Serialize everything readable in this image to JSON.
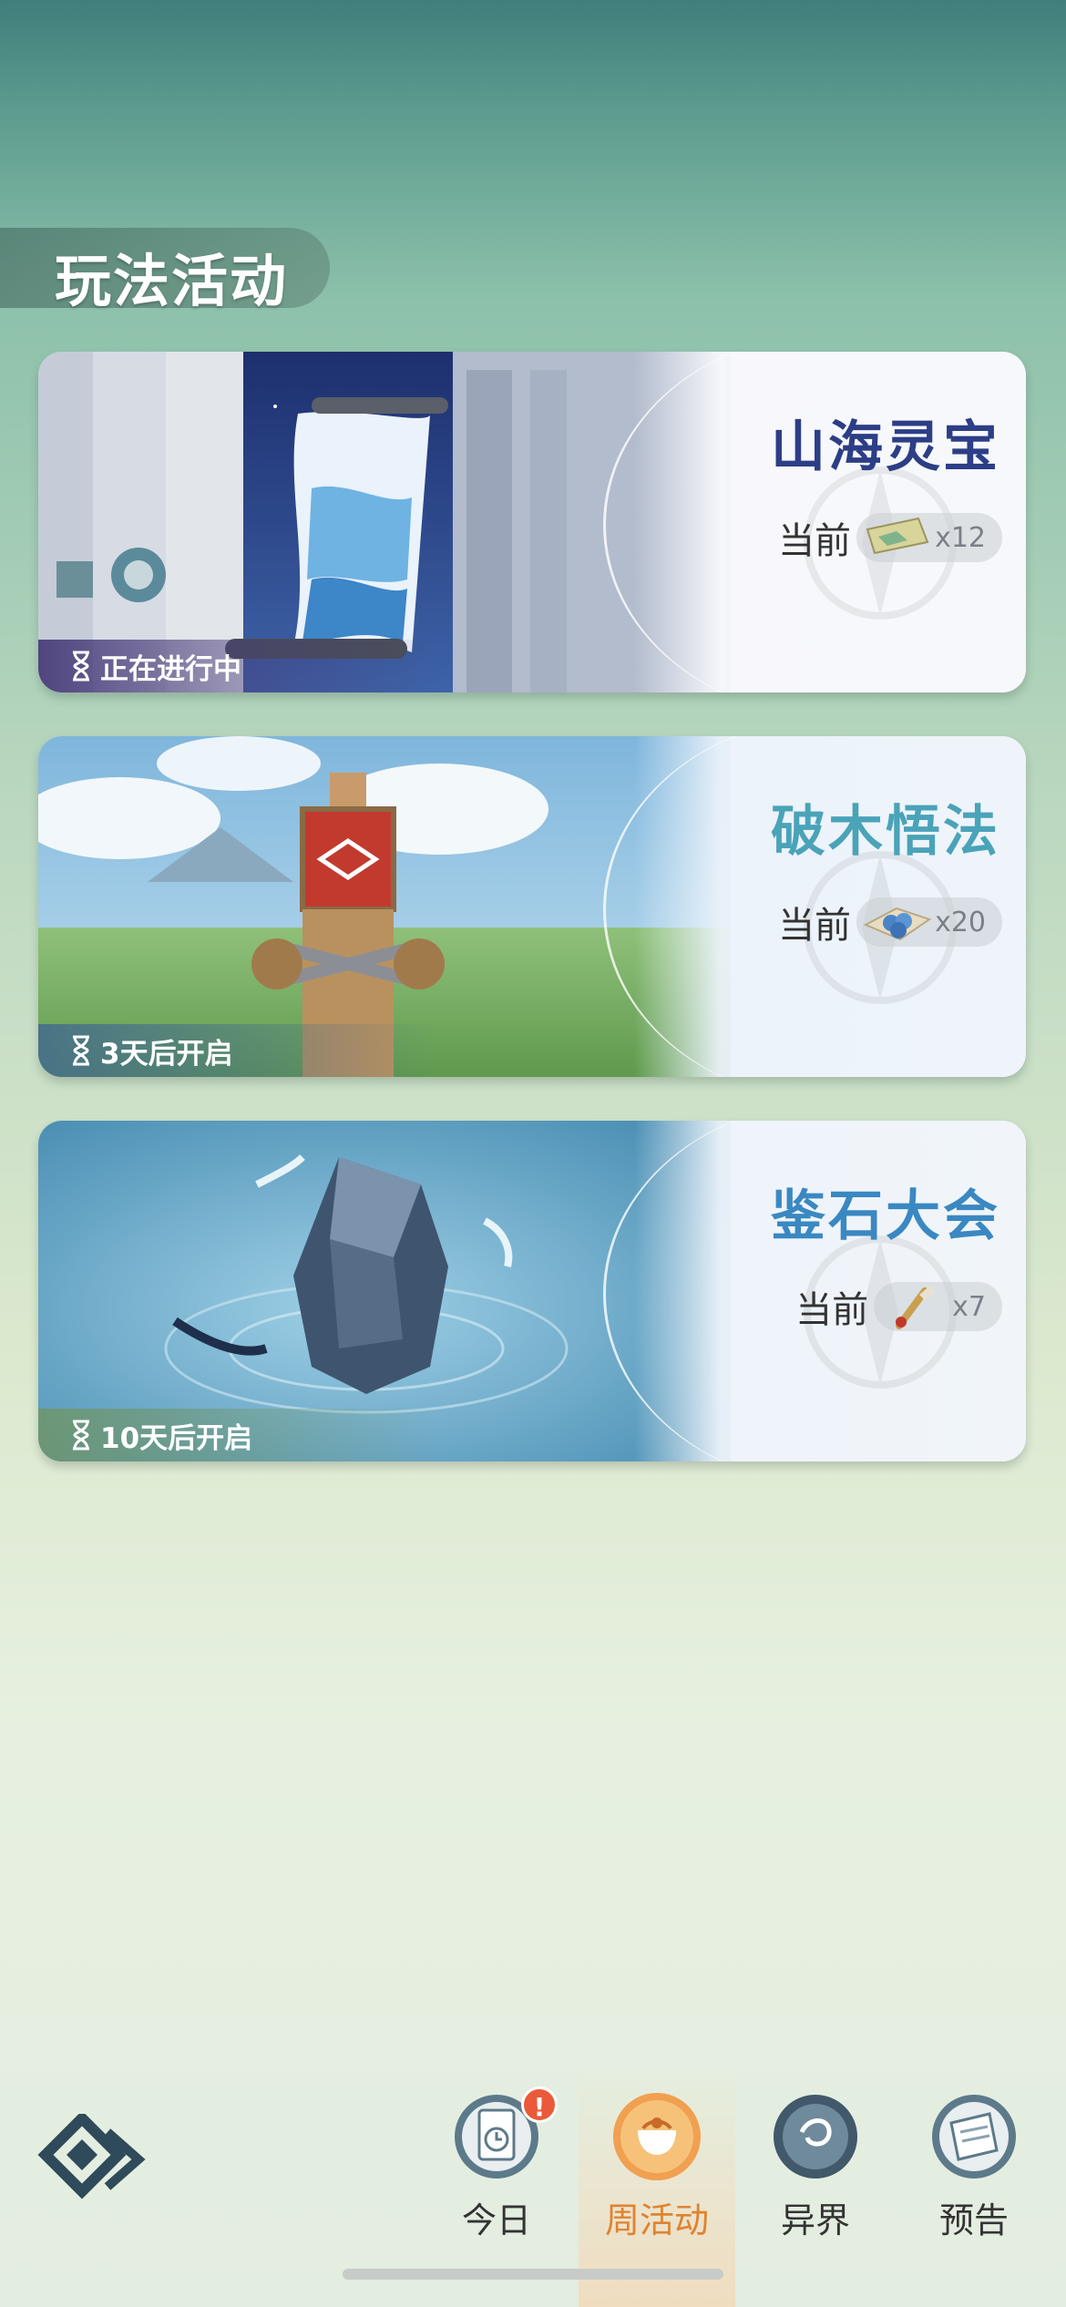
{
  "section": {
    "title": "玩法活动"
  },
  "cards": [
    {
      "name": "山海灵宝",
      "current_label": "当前",
      "count": "x12",
      "status": "正在进行中",
      "name_color": "#2c3e86",
      "status_color": "#4a3f7a",
      "item_icon": "scroll-map-icon"
    },
    {
      "name": "破木悟法",
      "current_label": "当前",
      "count": "x20",
      "status": "3天后开启",
      "name_color": "#4aa3b8",
      "status_color": "#4c7c93",
      "item_icon": "blue-eggs-icon"
    },
    {
      "name": "鉴石大会",
      "current_label": "当前",
      "count": "x7",
      "status": "10天后开启",
      "name_color": "#3a88c2",
      "status_color": "#6e9a72",
      "item_icon": "chisel-tool-icon"
    }
  ],
  "nav": {
    "items": [
      {
        "label": "今日",
        "icon": "calendar-clock-icon"
      },
      {
        "label": "周活动",
        "icon": "gift-bag-icon",
        "active": true
      },
      {
        "label": "异界",
        "icon": "swirl-emblem-icon"
      },
      {
        "label": "预告",
        "icon": "scroll-icon"
      }
    ],
    "badge": "!"
  }
}
